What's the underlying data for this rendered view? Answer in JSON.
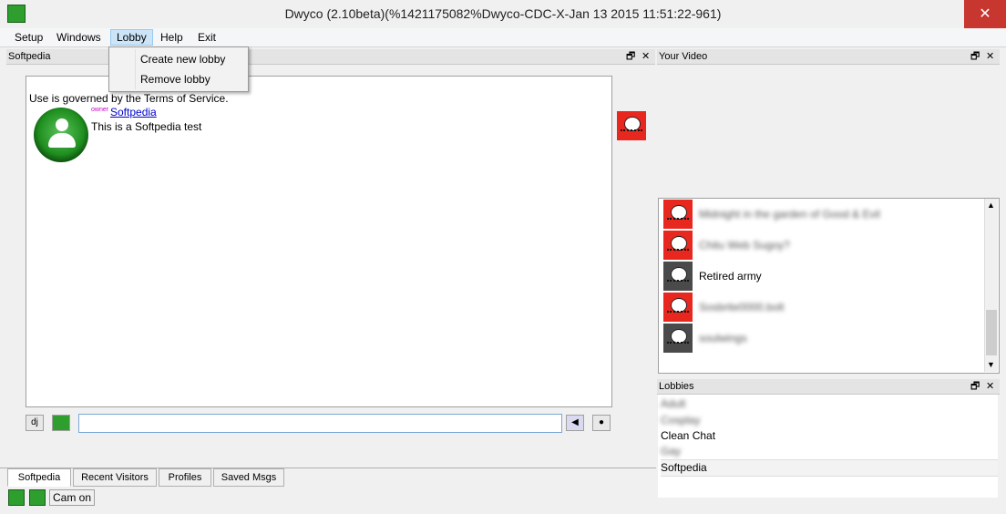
{
  "window": {
    "title": "Dwyco (2.10beta)(%1421175082%Dwyco-CDC-X-Jan 13 2015 11:51:22-961)",
    "close_glyph": "✕"
  },
  "menubar": {
    "items": [
      "Setup",
      "Windows",
      "Lobby",
      "Help",
      "Exit"
    ],
    "active": "Lobby"
  },
  "lobby_menu": {
    "items": [
      "Create new lobby",
      "Remove lobby"
    ]
  },
  "chat_panel": {
    "title": "Softpedia",
    "restore_glyph": "🗗",
    "close_glyph": "✕",
    "terms_text": "Use is governed by the Terms of Service.",
    "owner_tag": "owner",
    "owner_name": "Softpedia",
    "message": "This is a Softpedia test",
    "dj_label": "dj",
    "input_value": ""
  },
  "video_panel": {
    "title": "Your Video",
    "restore_glyph": "🗗",
    "close_glyph": "✕"
  },
  "users": [
    {
      "name": "Midnight in the garden of Good & Evil",
      "blurred": true,
      "thumb": "red"
    },
    {
      "name": "Chitu Web Sugoy?",
      "blurred": true,
      "thumb": "red"
    },
    {
      "name": "Retired army",
      "blurred": false,
      "thumb": "gray"
    },
    {
      "name": "Sosbrite0000.bolt",
      "blurred": true,
      "thumb": "red"
    },
    {
      "name": "soulwings",
      "blurred": true,
      "thumb": "gray"
    }
  ],
  "lobbies_panel": {
    "title": "Lobbies",
    "restore_glyph": "🗗",
    "close_glyph": "✕",
    "items": [
      {
        "name": "Adult",
        "blurred": true
      },
      {
        "name": "Cosplay",
        "blurred": true
      },
      {
        "name": "Clean Chat",
        "blurred": false
      },
      {
        "name": "Gay",
        "blurred": true
      },
      {
        "name": "Softpedia",
        "blurred": false,
        "selected": true
      }
    ]
  },
  "tabs": [
    "Softpedia",
    "Recent Visitors",
    "Profiles",
    "Saved Msgs"
  ],
  "status": {
    "cam_label": "Cam on"
  },
  "icons": {
    "app": "dwyco-app-icon",
    "status1": "dwyco-status-icon",
    "status2": "dwyco-status-icon"
  },
  "colors": {
    "close_red": "#c7362f",
    "thumb_red": "#e8271f",
    "avatar_green": "#1f8f1f",
    "link_blue": "#0000cc",
    "owner_magenta": "#cc00cc"
  }
}
